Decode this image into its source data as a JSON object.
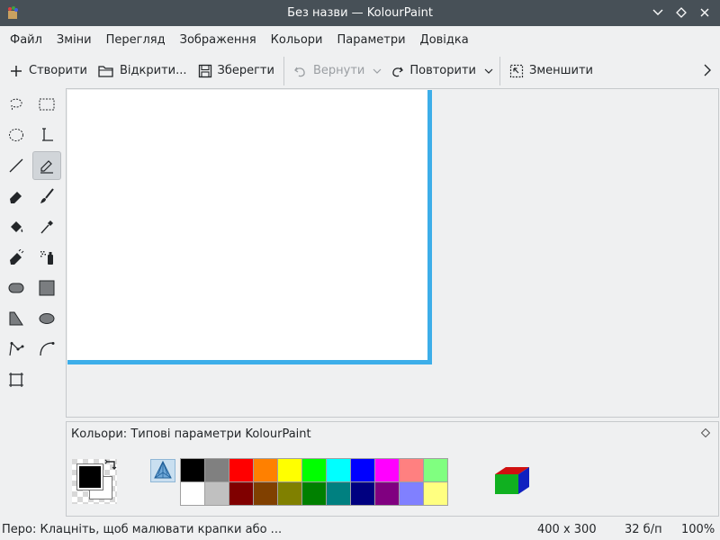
{
  "window": {
    "title": "Без назви — KolourPaint"
  },
  "menu": [
    "Файл",
    "Зміни",
    "Перегляд",
    "Зображення",
    "Кольори",
    "Параметри",
    "Довідка"
  ],
  "toolbar": {
    "new_label": "Створити",
    "open_label": "Відкрити...",
    "save_label": "Зберегти",
    "undo_label": "Вернути",
    "redo_label": "Повторити",
    "zoom_out_label": "Зменшити"
  },
  "tools": [
    "free-form-selection",
    "rectangular-selection",
    "elliptical-selection",
    "text",
    "line",
    "pen",
    "eraser",
    "brush",
    "flood-fill",
    "color-picker",
    "color-eraser",
    "spraycan",
    "rounded-rectangle",
    "rectangle",
    "polygon",
    "ellipse",
    "polyline",
    "curve",
    "zoom"
  ],
  "active_tool": "pen",
  "colors_dock": {
    "title": "Кольори: Типові параметри KolourPaint",
    "foreground": "#000000",
    "background": "#ffffff",
    "palette_top": [
      "#000000",
      "#808080",
      "#ff0000",
      "#ff8000",
      "#ffff00",
      "#00ff00",
      "#00ffff",
      "#0000ff",
      "#ff00ff",
      "#ff8080",
      "#80ff80"
    ],
    "palette_bottom": [
      "#ffffff",
      "#c0c0c0",
      "#800000",
      "#804000",
      "#808000",
      "#008000",
      "#008080",
      "#000080",
      "#800080",
      "#8080ff",
      "#ffff80"
    ]
  },
  "status": {
    "message": "Перо: Клацніть, щоб малювати крапки або ...",
    "image_size": "400 x 300",
    "color_depth": "32 б/п",
    "zoom": "100%"
  },
  "colors": {
    "accent": "#3daee9",
    "titlebar": "#475057"
  }
}
